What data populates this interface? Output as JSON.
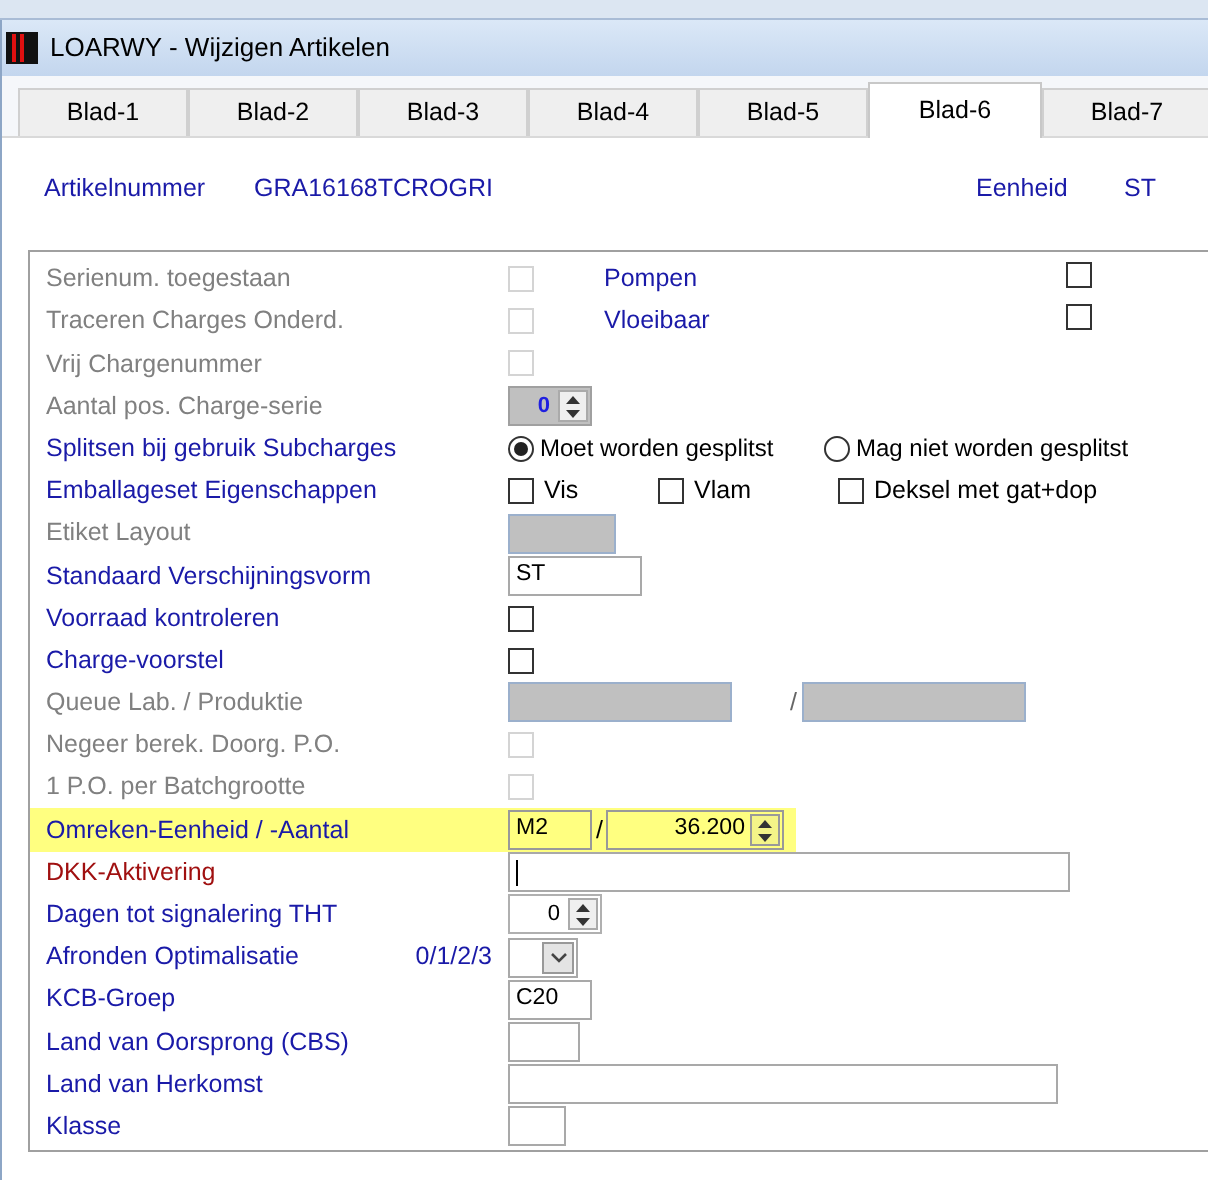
{
  "window": {
    "title": "LOARWY - Wijzigen Artikelen"
  },
  "tabs": [
    {
      "label": "Blad-1",
      "selected": false
    },
    {
      "label": "Blad-2",
      "selected": false
    },
    {
      "label": "Blad-3",
      "selected": false
    },
    {
      "label": "Blad-4",
      "selected": false
    },
    {
      "label": "Blad-5",
      "selected": false
    },
    {
      "label": "Blad-6",
      "selected": true
    },
    {
      "label": "Blad-7",
      "selected": false
    }
  ],
  "header": {
    "article_label": "Artikelnummer",
    "article_number": "GRA16168TCROGRI",
    "unit_label": "Eenheid",
    "unit": "ST"
  },
  "rows": [
    {
      "kind": "check",
      "label": "Serienum. toegestaan",
      "disabled": true,
      "highlighted": false,
      "alert": false,
      "checked": false,
      "extra": {
        "label": "Pompen",
        "checked": false
      }
    },
    {
      "kind": "check",
      "label": "Traceren Charges Onderd.",
      "disabled": true,
      "highlighted": false,
      "alert": false,
      "checked": false,
      "extra": {
        "label": "Vloeibaar",
        "checked": false
      }
    },
    {
      "kind": "check",
      "label": "Vrij Chargenummer",
      "disabled": true,
      "highlighted": false,
      "alert": false,
      "checked": false
    },
    {
      "kind": "spin",
      "label": "Aantal pos. Charge-serie",
      "disabled": true,
      "highlighted": false,
      "alert": false,
      "value": "0"
    },
    {
      "kind": "radio",
      "label": "Splitsen bij gebruik Subcharges",
      "disabled": false,
      "highlighted": false,
      "alert": false,
      "options": [
        {
          "label": "Moet worden gesplitst",
          "selected": true
        },
        {
          "label": "Mag niet worden gesplitst",
          "selected": false
        }
      ]
    },
    {
      "kind": "checks",
      "label": "Emballageset Eigenschappen",
      "disabled": false,
      "highlighted": false,
      "alert": false,
      "options": [
        {
          "label": "Vis",
          "checked": false
        },
        {
          "label": "Vlam",
          "checked": false
        },
        {
          "label": "Deksel met gat+dop",
          "checked": false
        }
      ]
    },
    {
      "kind": "field",
      "label": "Etiket Layout",
      "disabled": true,
      "highlighted": false,
      "alert": false
    },
    {
      "kind": "field",
      "label": "Standaard Verschijningsvorm",
      "disabled": false,
      "highlighted": false,
      "alert": false,
      "value": "ST"
    },
    {
      "kind": "check",
      "label": "Voorraad kontroleren",
      "disabled": false,
      "highlighted": false,
      "alert": false,
      "checked": false
    },
    {
      "kind": "check",
      "label": "Charge-voorstel",
      "disabled": false,
      "highlighted": false,
      "alert": false,
      "checked": false
    },
    {
      "kind": "pair",
      "label": "Queue Lab. / Produktie",
      "disabled": true,
      "highlighted": false,
      "alert": false,
      "separator": "/"
    },
    {
      "kind": "check",
      "label": "Negeer berek. Doorg. P.O.",
      "disabled": true,
      "highlighted": false,
      "alert": false,
      "checked": false
    },
    {
      "kind": "check",
      "label": "1 P.O. per Batchgrootte",
      "disabled": true,
      "highlighted": false,
      "alert": false,
      "checked": false
    },
    {
      "kind": "pair_spin",
      "label": "Omreken-Eenheid / -Aantal",
      "disabled": false,
      "highlighted": true,
      "alert": false,
      "separator": "/",
      "values": [
        "M2",
        "36.200"
      ]
    },
    {
      "kind": "field",
      "label": "DKK-Aktivering",
      "disabled": false,
      "highlighted": false,
      "alert": true,
      "focused": true
    },
    {
      "kind": "spin",
      "label": "Dagen tot signalering THT",
      "disabled": false,
      "highlighted": false,
      "alert": false,
      "value": "0"
    },
    {
      "kind": "combo",
      "label": "Afronden Optimalisatie",
      "disabled": false,
      "highlighted": false,
      "alert": false,
      "hint": "0/1/2/3"
    },
    {
      "kind": "field",
      "label": "KCB-Groep",
      "disabled": false,
      "highlighted": false,
      "alert": false,
      "value": "C20"
    },
    {
      "kind": "field",
      "label": "Land van Oorsprong (CBS)",
      "disabled": false,
      "highlighted": false,
      "alert": false
    },
    {
      "kind": "field",
      "label": "Land van Herkomst",
      "disabled": false,
      "highlighted": false,
      "alert": false
    },
    {
      "kind": "field",
      "label": "Klasse",
      "disabled": false,
      "highlighted": false,
      "alert": false
    }
  ]
}
